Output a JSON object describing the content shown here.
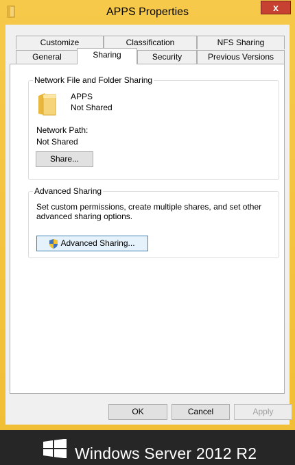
{
  "window": {
    "title": "APPS Properties",
    "close_label": "x"
  },
  "tabs": {
    "row1": [
      "Customize",
      "Classification",
      "NFS Sharing"
    ],
    "row2": [
      "General",
      "Sharing",
      "Security",
      "Previous Versions"
    ],
    "active": "Sharing"
  },
  "network_sharing": {
    "group_label": "Network File and Folder Sharing",
    "folder_name": "APPS",
    "share_state": "Not Shared",
    "path_label": "Network Path:",
    "path_value": "Not Shared",
    "share_button": "Share..."
  },
  "advanced_sharing": {
    "group_label": "Advanced Sharing",
    "description": "Set custom permissions, create multiple shares, and set other advanced sharing options.",
    "button": "Advanced Sharing..."
  },
  "dialog_buttons": {
    "ok": "OK",
    "cancel": "Cancel",
    "apply": "Apply"
  },
  "branding": {
    "text": "Windows Server 2012 R2"
  },
  "colors": {
    "title_bar": "#f1bf36",
    "close_button": "#c74133",
    "footer": "#262626"
  }
}
